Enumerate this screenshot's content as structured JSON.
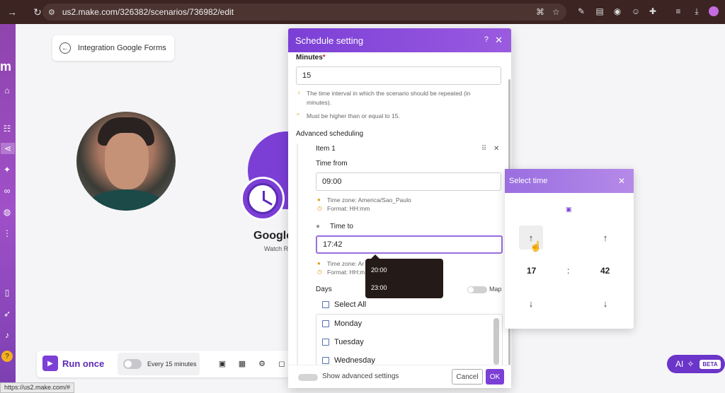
{
  "browser": {
    "url": "us2.make.com/326382/scenarios/736982/edit",
    "status_url": "https://us2.make.com/#"
  },
  "scenario": {
    "back_label": "Integration Google Forms",
    "module_title": "Google",
    "module_sub": "Watch R"
  },
  "toolbar": {
    "run_label": "Run once",
    "schedule_label": "Every 15 minutes"
  },
  "ai": {
    "label": "AI",
    "badge": "BETA"
  },
  "dialog": {
    "title": "Schedule setting",
    "minutes_label": "Minutes",
    "minutes_req": "*",
    "minutes_value": "15",
    "minutes_hint": "The time interval in which the scenario should be repeated (in minutes).",
    "minutes_warning": "Must be higher than or equal to 15.",
    "advanced_label": "Advanced scheduling",
    "item_label": "Item 1",
    "time_from_label": "Time from",
    "time_from_value": "09:00",
    "tz_hint": "Time zone: America/Sao_Paulo",
    "format_hint": "Format: HH:mm",
    "time_to_label": "Time to",
    "time_to_value": "17:42",
    "tz_hint_2": "Time zone: Ar",
    "format_hint_2": "Format: HH:mm",
    "days_label": "Days",
    "map_label": "Map",
    "select_all": "Select All",
    "days": [
      "Monday",
      "Tuesday",
      "Wednesday"
    ],
    "show_advanced": "Show advanced settings",
    "cancel": "Cancel",
    "ok": "OK"
  },
  "suggestions": [
    "20:00",
    "23:00"
  ],
  "time_picker": {
    "title": "Select time",
    "hour": "17",
    "separator": ":",
    "minute": "42"
  },
  "colors": {
    "brand": "#7b3fd6",
    "chrome": "#3b2422"
  }
}
